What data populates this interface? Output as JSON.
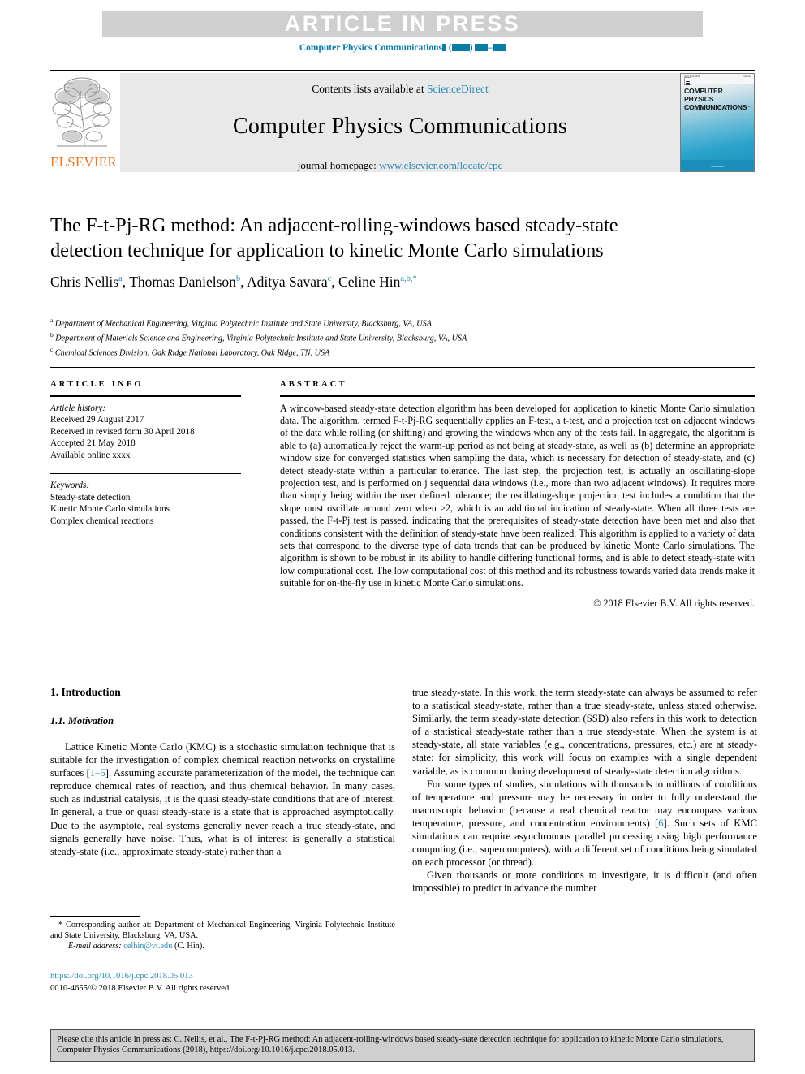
{
  "banner": {
    "text": "ARTICLE IN PRESS"
  },
  "running_head": {
    "journal": "Computer Physics Communications",
    "volume_placeholder": "▮",
    "year_placeholder": "(▮▮▮▮)",
    "pages_placeholder": "▮▮▮–▮▮▮"
  },
  "masthead": {
    "contents_prefix": "Contents lists available at ",
    "contents_link": "ScienceDirect",
    "journal_title": "Computer Physics Communications",
    "homepage_prefix": "journal homepage: ",
    "homepage_link": "www.elsevier.com/locate/cpc",
    "publisher_wordmark": "ELSEVIER",
    "cover": {
      "title_line1": "COMPUTER PHYSICS",
      "title_line2": "COMMUNICATIONS",
      "subtitle": "An international journal and program library for computational physics and physical chemistry",
      "top_left_caption": "ISSN 0010-4655",
      "top_right_caption": "Volume",
      "foot_caption": "ScienceDirect"
    }
  },
  "article": {
    "title": "The F-t-Pj-RG method: An adjacent-rolling-windows based steady-state detection technique for application to kinetic Monte Carlo simulations",
    "authors": [
      {
        "name": "Chris Nellis",
        "marks": "a"
      },
      {
        "name": "Thomas Danielson",
        "marks": "b"
      },
      {
        "name": "Aditya Savara",
        "marks": "c"
      },
      {
        "name": "Celine Hin",
        "marks": "a,b,*"
      }
    ],
    "affiliations": [
      {
        "mark": "a",
        "text": "Department of Mechanical Engineering, Virginia Polytechnic Institute and State University, Blacksburg, VA, USA"
      },
      {
        "mark": "b",
        "text": "Department of Materials Science and Engineering, Virginia Polytechnic Institute and State University, Blacksburg, VA, USA"
      },
      {
        "mark": "c",
        "text": "Chemical Sciences Division, Oak Ridge National Laboratory, Oak Ridge, TN, USA"
      }
    ]
  },
  "article_info": {
    "heading": "ARTICLE INFO",
    "history_label": "Article history:",
    "history": [
      "Received 29 August 2017",
      "Received in revised form 30 April 2018",
      "Accepted 21 May 2018",
      "Available online xxxx"
    ],
    "keywords_label": "Keywords:",
    "keywords": [
      "Steady-state detection",
      "Kinetic Monte Carlo simulations",
      "Complex chemical reactions"
    ]
  },
  "abstract": {
    "heading": "ABSTRACT",
    "text": "A window-based steady-state detection algorithm has been developed for application to kinetic Monte Carlo simulation data. The algorithm, termed F-t-Pj-RG sequentially applies an F-test, a t-test, and a projection test on adjacent windows of the data while rolling (or shifting) and growing the windows when any of the tests fail. In aggregate, the algorithm is able to (a) automatically reject the warm-up period as not being at steady-state, as well as (b) determine an appropriate window size for converged statistics when sampling the data, which is necessary for detection of steady-state, and (c) detect steady-state within a particular tolerance. The last step, the projection test, is actually an oscillating-slope projection test, and is performed on j sequential data windows (i.e., more than two adjacent windows). It requires more than simply being within the user defined tolerance; the oscillating-slope projection test includes a condition that the slope must oscillate around zero when ≥2, which is an additional indication of steady-state. When all three tests are passed, the F-t-Pj test is passed, indicating that the prerequisites of steady-state detection have been met and also that conditions consistent with the definition of steady-state have been realized. This algorithm is applied to a variety of data sets that correspond to the diverse type of data trends that can be produced by kinetic Monte Carlo simulations. The algorithm is shown to be robust in its ability to handle differing functional forms, and is able to detect steady-state with low computational cost. The low computational cost of this method and its robustness towards varied data trends make it suitable for on-the-fly use in kinetic Monte Carlo simulations.",
    "copyright": "© 2018 Elsevier B.V. All rights reserved."
  },
  "body": {
    "section_number_title": "1. Introduction",
    "subsection_number_title": "1.1. Motivation",
    "left_paragraph_1_a": "Lattice Kinetic Monte Carlo (KMC) is a stochastic simulation technique that is suitable for the investigation of complex chemical reaction networks on crystalline surfaces [",
    "left_ref_1": "1–5",
    "left_paragraph_1_b": "]. Assuming accurate parameterization of the model, the technique can reproduce chemical rates of reaction, and thus chemical behavior. In many cases, such as industrial catalysis, it is the quasi steady-state conditions that are of interest. In general, a true or quasi steady-state is a state that is approached asymptotically. Due to the asymptote, real systems generally never reach a true steady-state, and signals generally have noise. Thus, what is of interest is generally a statistical steady-state (i.e., approximate steady-state) rather than a",
    "right_paragraph_1": "true steady-state. In this work, the term steady-state can always be assumed to refer to a statistical steady-state, rather than a true steady-state, unless stated otherwise. Similarly, the term steady-state detection (SSD) also refers in this work to detection of a statistical steady-state rather than a true steady-state. When the system is at steady-state, all state variables (e.g., concentrations, pressures, etc.) are at steady-state: for simplicity, this work will focus on examples with a single dependent variable, as is common during development of steady-state detection algorithms.",
    "right_paragraph_2_a": "For some types of studies, simulations with thousands to millions of conditions of temperature and pressure may be necessary in order to fully understand the macroscopic behavior (because a real chemical reactor may encompass various temperature, pressure, and concentration environments) [",
    "right_ref_6": "6",
    "right_paragraph_2_b": "]. Such sets of KMC simulations can require asynchronous parallel processing using high performance computing (i.e., supercomputers), with a different set of conditions being simulated on each processor (or thread).",
    "right_paragraph_3": "Given thousands or more conditions to investigate, it is difficult (and often impossible) to predict in advance the number"
  },
  "footnote": {
    "corresponding": "* Corresponding author at: Department of Mechanical Engineering, Virginia Polytechnic Institute and State University, Blacksburg, VA, USA.",
    "email_label": "E-mail address:",
    "email": "celhin@vt.edu",
    "email_suffix": "(C. Hin).",
    "doi": "https://doi.org/10.1016/j.cpc.2018.05.013",
    "issn_copyright": "0010-4655/© 2018 Elsevier B.V. All rights reserved."
  },
  "cite_box": {
    "text": "Please cite this article in press as: C. Nellis, et al., The F-t-Pj-RG method: An adjacent-rolling-windows based steady-state detection technique for application to kinetic Monte Carlo simulations, Computer Physics Communications (2018), https://doi.org/10.1016/j.cpc.2018.05.013."
  },
  "colors": {
    "link": "#2b8ab5",
    "banner_bg": "#cfcfcf",
    "masthead_bg": "#e9e9e9",
    "elsevier_orange": "#e87722",
    "running_head": "#0a7ca5"
  }
}
